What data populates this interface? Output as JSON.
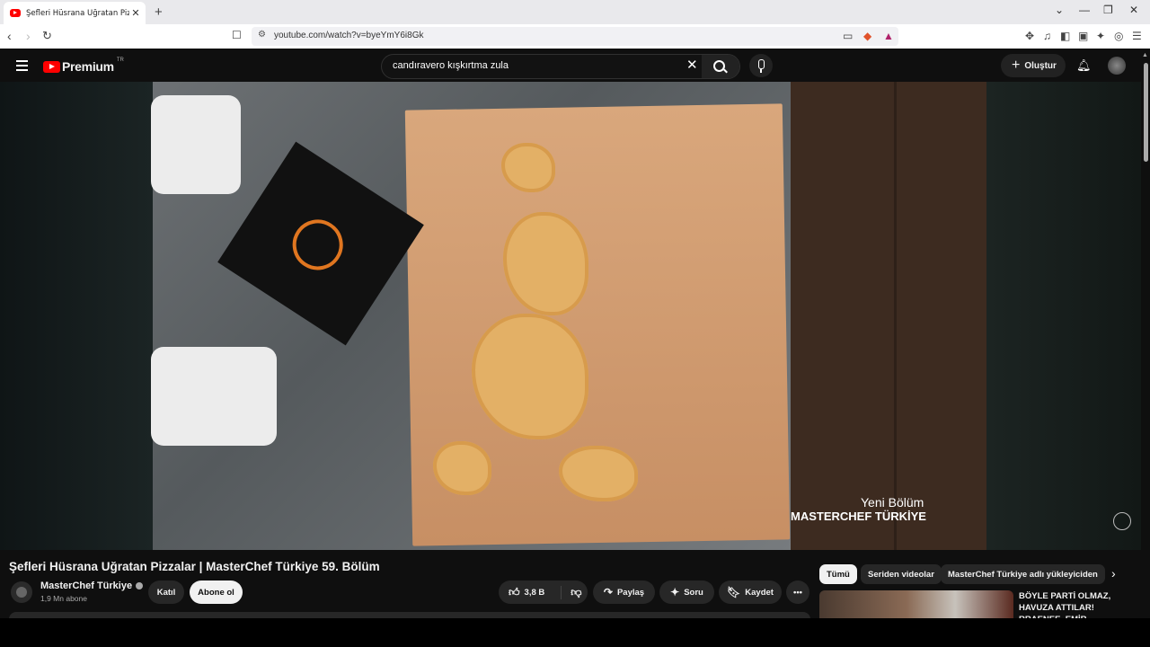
{
  "browser": {
    "tab_title": "Şefleri Hüsrana Uğratan Pizzalar",
    "tab_close": "✕",
    "new_tab": "+",
    "url": "youtube.com/watch?v=byeYmY6i8Gk",
    "controls": {
      "minimize": "⌄",
      "restore": "—",
      "maximize": "❐",
      "close": "✕"
    }
  },
  "youtube": {
    "logo_text": "Premium",
    "country_code": "TR",
    "search_value": "candıravero kışkırtma zula",
    "create_label": "Oluştur"
  },
  "video": {
    "watermark_line1": "Yeni Bölüm",
    "watermark_line2": "MASTERCHEF TÜRKİYE",
    "title": "Şefleri Hüsrana Uğratan Pizzalar | MasterChef Türkiye 59. Bölüm"
  },
  "channel": {
    "name": "MasterChef Türkiye",
    "subscribers": "1,9 Mn abone",
    "join_label": "Katıl",
    "subscribe_label": "Abone ol"
  },
  "actions": {
    "like_count": "3,8 B",
    "share_label": "Paylaş",
    "ask_label": "Soru",
    "save_label": "Kaydet"
  },
  "chips": [
    "Tümü",
    "Seriden videolar",
    "MasterChef Türkiye adlı yükleyiciden"
  ],
  "recommendation": {
    "title": "BÖYLE PARTİ OLMAZ, HAVUZA ATTILAR! RRAENEE, EMİR KİRAZOĞLU ERAY"
  },
  "colors": {
    "accent": "#ff0000",
    "background": "#0f0f0f",
    "pill": "#272727"
  }
}
